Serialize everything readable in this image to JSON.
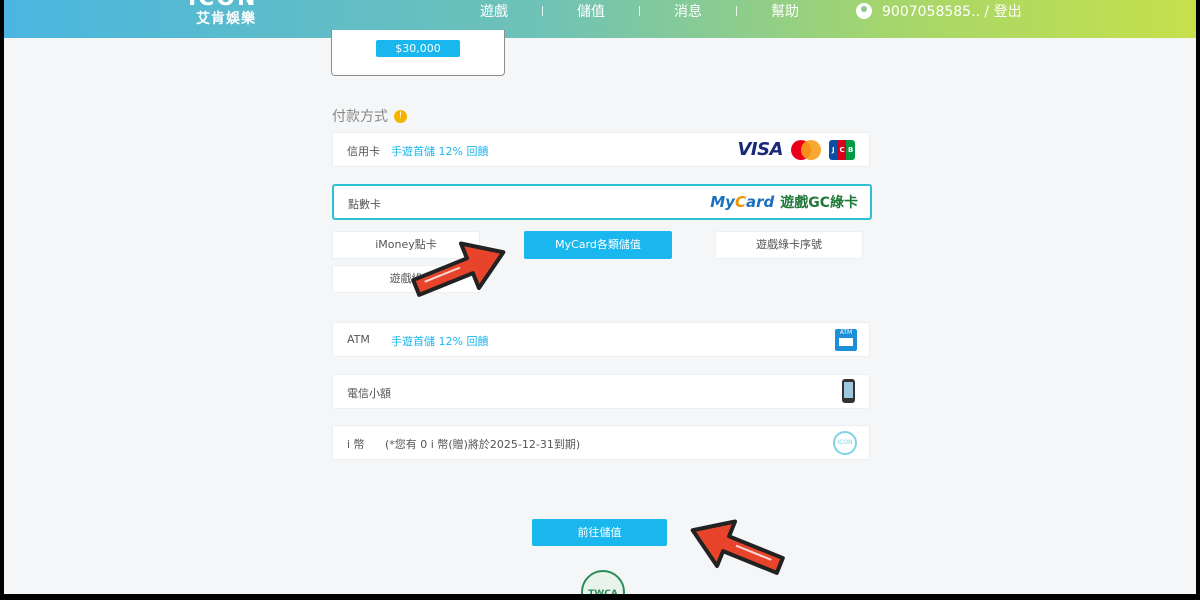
{
  "header": {
    "logo_text": "ICON",
    "logo_subtitle": "艾肯娛樂",
    "nav": [
      "遊戲",
      "儲值",
      "消息",
      "幫助"
    ],
    "user_label": "9007058585.. / 登出"
  },
  "amount": {
    "selected_label": "$30,000"
  },
  "payment": {
    "section_title": "付款方式",
    "info_icon": "!",
    "methods": {
      "credit_card": {
        "label": "信用卡",
        "promo": "手遊首儲 12% 回饋"
      },
      "point_card": {
        "label": "點數卡"
      },
      "atm": {
        "label": "ATM",
        "promo": "手遊首儲 12% 回饋",
        "icon_text": "ATM"
      },
      "telecom": {
        "label": "電信小額"
      },
      "icoin": {
        "label": "i 幣",
        "note": "(*您有 0 i 幣(贈)將於2025-12-31到期)",
        "icon_text": "ICON"
      }
    },
    "point_options": {
      "imoney": "iMoney點卡",
      "mycard": "MyCard各類儲值",
      "game_card_serial": "遊戲綠卡序號",
      "game_card_partial": "遊戲綠"
    },
    "logos": {
      "visa": "VISA",
      "jcb": [
        "J",
        "C",
        "B"
      ],
      "mycard_text": "My",
      "mycard_c": "C",
      "mycard_rest": "ard",
      "green_card": "遊戲GC綠卡"
    }
  },
  "submit_label": "前往儲值",
  "badge_text": "TWCA",
  "colors": {
    "accent": "#1ab6ee",
    "arrow": "#e8442c"
  },
  "icons": [
    "user-icon",
    "info-icon",
    "visa-logo",
    "mastercard-logo",
    "jcb-logo",
    "mycard-logo",
    "green-card-logo",
    "atm-icon",
    "phone-icon",
    "icon-coin-icon",
    "twca-badge",
    "red-arrow-icon"
  ]
}
